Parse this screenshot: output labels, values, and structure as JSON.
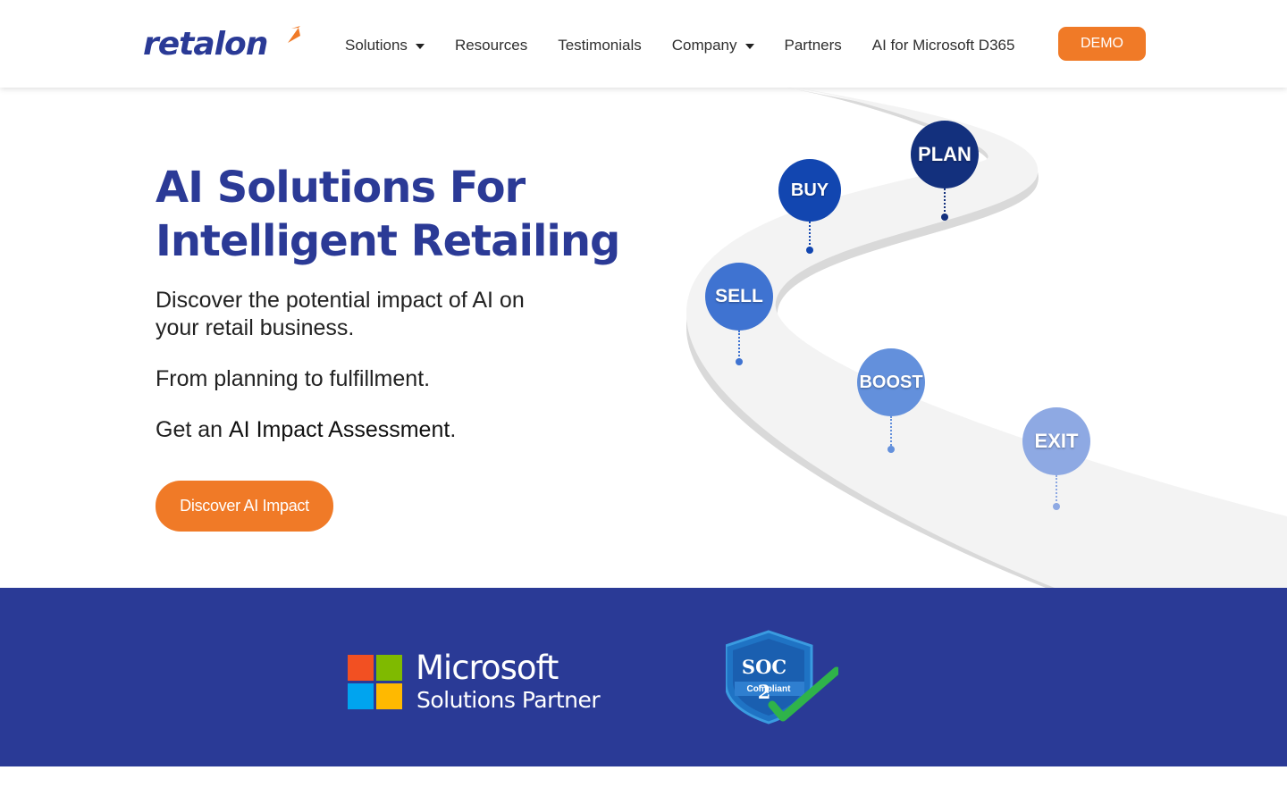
{
  "header": {
    "logo_text": "retalon",
    "nav": [
      {
        "label": "Solutions",
        "has_dropdown": true
      },
      {
        "label": "Resources",
        "has_dropdown": false
      },
      {
        "label": "Testimonials",
        "has_dropdown": false
      },
      {
        "label": "Company",
        "has_dropdown": true
      },
      {
        "label": "Partners",
        "has_dropdown": false
      },
      {
        "label": "AI for Microsoft D365",
        "has_dropdown": false
      }
    ],
    "demo_label": "DEMO"
  },
  "hero": {
    "title_line1": "AI Solutions For",
    "title_line2": "Intelligent Retailing",
    "p1": "Discover the potential impact of AI on your retail business.",
    "p2": "From planning to fulfillment.",
    "p3_prefix": "Get an ",
    "p3_strong": "AI Impact Assessment",
    "p3_suffix": ".",
    "cta_label": "Discover AI Impact"
  },
  "road": {
    "pins": [
      {
        "label": "PLAN",
        "color": "#13307d"
      },
      {
        "label": "BUY",
        "color": "#1246b0"
      },
      {
        "label": "SELL",
        "color": "#3f73d1"
      },
      {
        "label": "BOOST",
        "color": "#6390dc"
      },
      {
        "label": "EXIT",
        "color": "#8ea9e3"
      }
    ]
  },
  "badges": {
    "microsoft_line1": "Microsoft",
    "microsoft_line2": "Solutions Partner",
    "soc_title": "SOC 2",
    "soc_sub": "Compliant"
  },
  "colors": {
    "brand_blue": "#2a3a96",
    "accent_orange": "#f07a27"
  }
}
